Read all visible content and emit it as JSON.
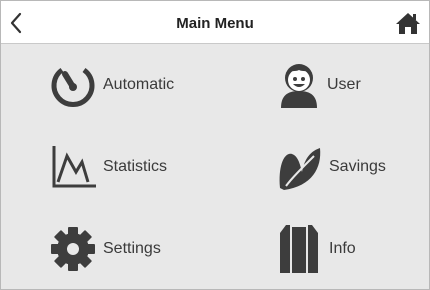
{
  "header": {
    "title": "Main Menu",
    "back_icon": "chevron-left-icon",
    "home_icon": "home-icon"
  },
  "menu": {
    "items": [
      {
        "label": "Automatic",
        "icon": "timer-icon"
      },
      {
        "label": "User",
        "icon": "user-icon"
      },
      {
        "label": "Statistics",
        "icon": "line-chart-icon"
      },
      {
        "label": "Savings",
        "icon": "leaf-icon"
      },
      {
        "label": "Settings",
        "icon": "gear-icon"
      },
      {
        "label": "Info",
        "icon": "info-icon"
      }
    ]
  },
  "colors": {
    "background": "#e8e8e8",
    "header": "#ffffff",
    "icon": "#3d3d3d",
    "text": "#3a3a3a"
  }
}
